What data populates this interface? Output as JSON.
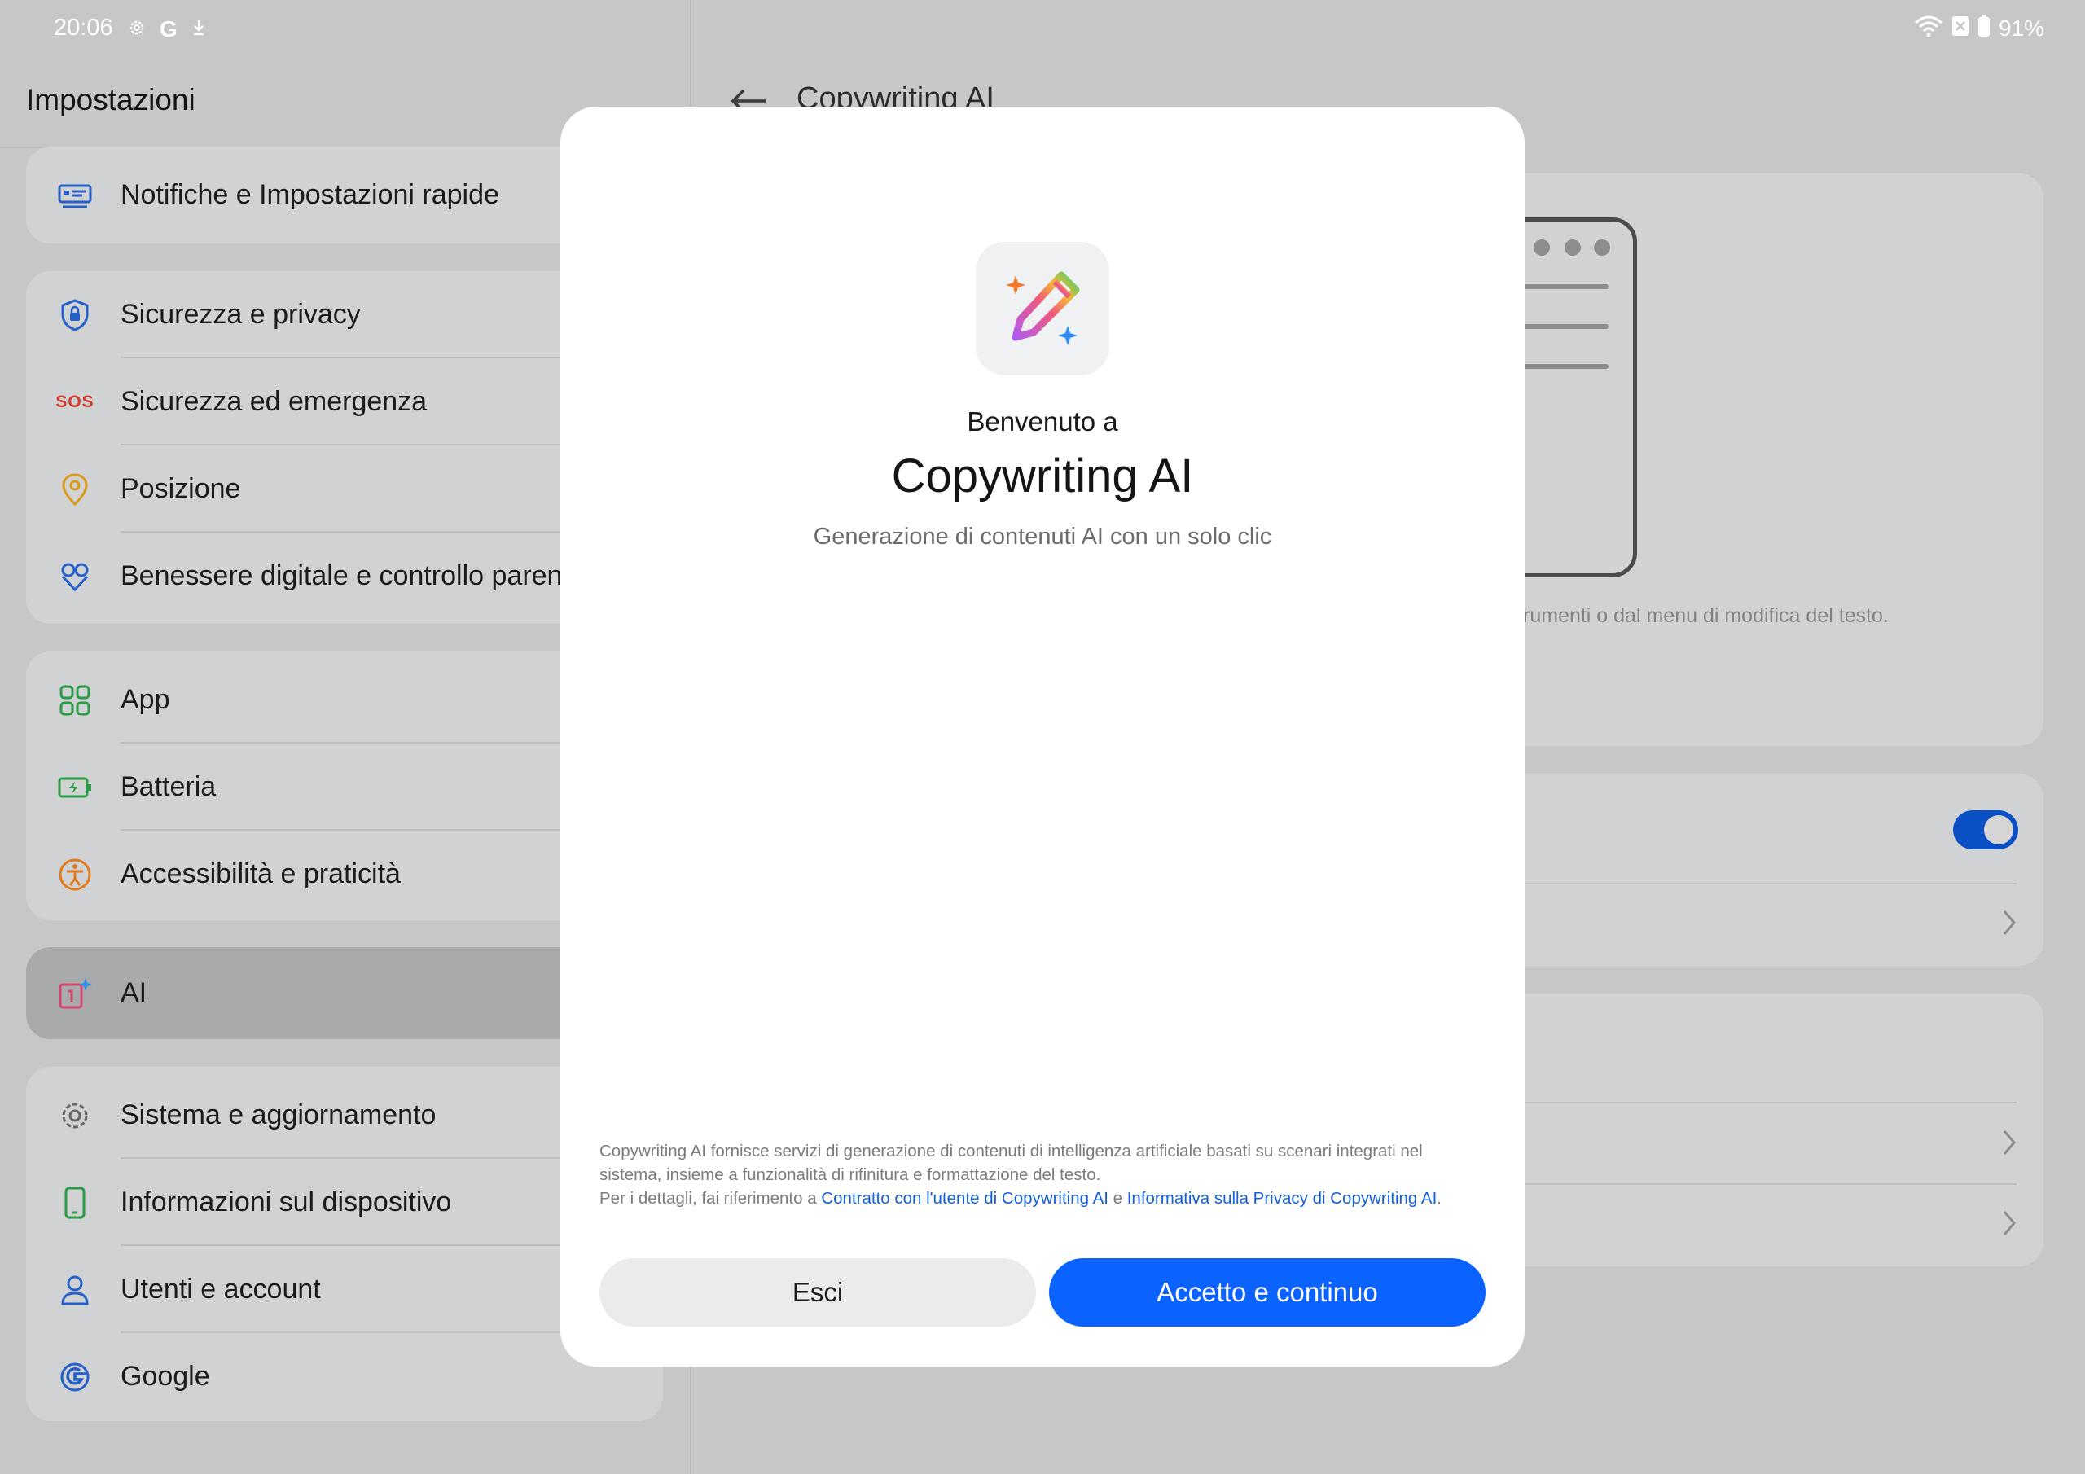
{
  "status_bar": {
    "time": "20:06",
    "battery": "91%",
    "left_icons": [
      "gear-icon",
      "google-g-icon",
      "download-icon"
    ],
    "right_icons": [
      "wifi-icon",
      "no-sim-icon",
      "battery-icon"
    ]
  },
  "settings": {
    "title": "Impostazioni",
    "groups": [
      {
        "items": [
          {
            "label": "Notifiche e Impostazioni rapide",
            "icon": "notifications-panel-icon"
          }
        ]
      },
      {
        "items": [
          {
            "label": "Sicurezza e privacy",
            "icon": "shield-lock-icon"
          },
          {
            "label": "Sicurezza ed emergenza",
            "icon": "sos-icon",
            "icon_text": "SOS"
          },
          {
            "label": "Posizione",
            "icon": "location-pin-icon"
          },
          {
            "label": "Benessere digitale e controllo parentale",
            "icon": "digital-wellbeing-icon"
          }
        ]
      },
      {
        "items": [
          {
            "label": "App",
            "icon": "apps-grid-icon"
          },
          {
            "label": "Batteria",
            "icon": "battery-charging-icon"
          },
          {
            "label": "Accessibilità e praticità",
            "icon": "accessibility-icon"
          }
        ]
      },
      {
        "items": [
          {
            "label": "AI",
            "icon": "ai-sparkle-icon",
            "selected": true
          }
        ]
      },
      {
        "items": [
          {
            "label": "Sistema e aggiornamento",
            "icon": "gear-icon"
          },
          {
            "label": "Informazioni sul dispositivo",
            "icon": "phone-icon"
          },
          {
            "label": "Utenti e account",
            "icon": "user-icon"
          },
          {
            "label": "Google",
            "icon": "google-g-icon"
          }
        ]
      }
    ]
  },
  "detail": {
    "title": "Copywriting AI",
    "hint_text": "rumenti o dal menu di modifica del testo.",
    "toggle_on": true
  },
  "dialog": {
    "welcome": "Benvenuto a",
    "app_name": "Copywriting AI",
    "subtitle": "Generazione di contenuti AI con un solo clic",
    "legal_line1": "Copywriting AI fornisce servizi di generazione di contenuti di intelligenza artificiale basati su scenari integrati nel sistema, insieme a funzionalità di rifinitura e formattazione del testo.",
    "legal_prefix": "Per i dettagli, fai riferimento a ",
    "link_terms": "Contratto con l'utente di Copywriting AI",
    "legal_and": " e ",
    "link_privacy": "Informativa sulla Privacy di Copywriting AI",
    "legal_end": ".",
    "btn_exit": "Esci",
    "btn_accept": "Accetto e continuo"
  },
  "colors": {
    "accent_blue": "#0a63ff",
    "link_blue": "#1460d4",
    "toggle_blue": "#0a4fc4"
  }
}
